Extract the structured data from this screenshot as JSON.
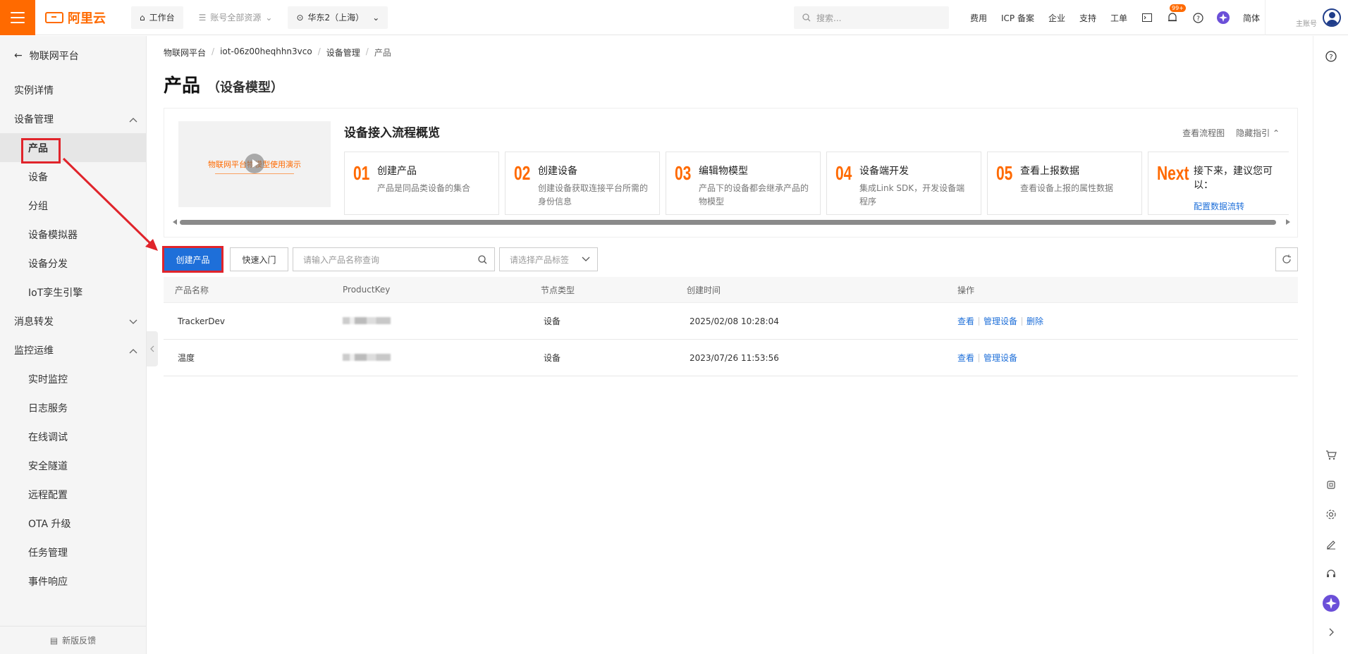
{
  "topbar": {
    "logo_text": "阿里云",
    "workbench": "工作台",
    "resources": "账号全部资源",
    "region": "华东2（上海）",
    "search_placeholder": "搜索...",
    "links": [
      "费用",
      "ICP 备案",
      "企业",
      "支持",
      "工单"
    ],
    "notif_badge": "99+",
    "lang": "简体",
    "account_sub": "主账号"
  },
  "sidebar": {
    "back_label": "物联网平台",
    "items": [
      {
        "label": "实例详情",
        "level": 1
      },
      {
        "label": "设备管理",
        "level": 1,
        "expanded": true
      },
      {
        "label": "产品",
        "level": 2,
        "active": true
      },
      {
        "label": "设备",
        "level": 2
      },
      {
        "label": "分组",
        "level": 2
      },
      {
        "label": "设备模拟器",
        "level": 2
      },
      {
        "label": "设备分发",
        "level": 2
      },
      {
        "label": "IoT孪生引擎",
        "level": 2
      },
      {
        "label": "消息转发",
        "level": 1,
        "expanded": false
      },
      {
        "label": "监控运维",
        "level": 1,
        "expanded": true
      },
      {
        "label": "实时监控",
        "level": 2
      },
      {
        "label": "日志服务",
        "level": 2
      },
      {
        "label": "在线调试",
        "level": 2
      },
      {
        "label": "安全隧道",
        "level": 2
      },
      {
        "label": "远程配置",
        "level": 2
      },
      {
        "label": "OTA 升级",
        "level": 2
      },
      {
        "label": "任务管理",
        "level": 2
      },
      {
        "label": "事件响应",
        "level": 2
      }
    ],
    "feedback": "新版反馈"
  },
  "breadcrumb": [
    "物联网平台",
    "iot-06z00heqhhn3vco",
    "设备管理",
    "产品"
  ],
  "page": {
    "title": "产品",
    "subtitle": "（设备模型）"
  },
  "guide": {
    "video_caption": "物联网平台物模型使用演示",
    "title": "设备接入流程概览",
    "view_flow": "查看流程图",
    "hide_guide": "隐藏指引",
    "steps": [
      {
        "num": "01",
        "title": "创建产品",
        "desc": "产品是同品类设备的集合"
      },
      {
        "num": "02",
        "title": "创建设备",
        "desc": "创建设备获取连接平台所需的身份信息"
      },
      {
        "num": "03",
        "title": "编辑物模型",
        "desc": "产品下的设备都会继承产品的物模型"
      },
      {
        "num": "04",
        "title": "设备端开发",
        "desc": "集成Link SDK，开发设备端程序"
      },
      {
        "num": "05",
        "title": "查看上报数据",
        "desc": "查看设备上报的属性数据"
      }
    ],
    "next": {
      "num": "Next",
      "title": "接下来，建议您可以：",
      "link": "配置数据流转"
    }
  },
  "toolbar": {
    "create": "创建产品",
    "quick_start": "快速入门",
    "search_placeholder": "请输入产品名称查询",
    "tag_placeholder": "请选择产品标签"
  },
  "table": {
    "headers": [
      "产品名称",
      "ProductKey",
      "节点类型",
      "创建时间",
      "操作"
    ],
    "rows": [
      {
        "name": "TrackerDev",
        "node_type": "设备",
        "created": "2025/02/08 10:28:04",
        "actions": [
          "查看",
          "管理设备",
          "删除"
        ]
      },
      {
        "name": "温度",
        "node_type": "设备",
        "created": "2023/07/26 11:53:56",
        "actions": [
          "查看",
          "管理设备"
        ]
      }
    ]
  },
  "colors": {
    "brand": "#ff6a00",
    "primary": "#1e6fd9",
    "annotation": "#e0242b"
  }
}
